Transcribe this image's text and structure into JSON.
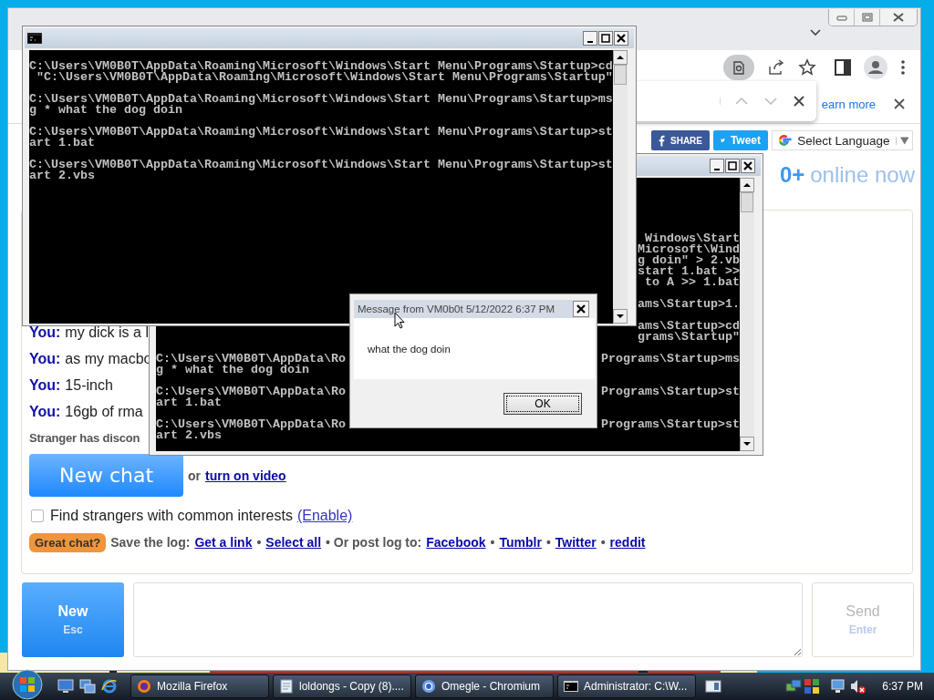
{
  "browser": {
    "infobar": {
      "link": "earn more"
    },
    "share": {
      "facebook": "SHARE",
      "twitter": "Tweet"
    },
    "language": {
      "label": "Select Language"
    },
    "online": {
      "count": "0+",
      "label": "online now"
    },
    "chat": {
      "messages": [
        {
          "who": "You:",
          "text": "my dick is a l"
        },
        {
          "who": "You:",
          "text": "as my macbo"
        },
        {
          "who": "You:",
          "text": "15-inch"
        },
        {
          "who": "You:",
          "text": "16gb of rma"
        }
      ],
      "status": "Stranger has discon",
      "new_chat": "New chat",
      "or": "or",
      "video_link": "turn on video",
      "interests": {
        "checked": false,
        "label": "Find strangers with common interests",
        "link": "(Enable)"
      },
      "great_chat": "Great chat?",
      "log": [
        {
          "kind": "label",
          "text": "Save the log:"
        },
        {
          "kind": "link",
          "text": "Get a link"
        },
        {
          "kind": "label",
          "text": "•"
        },
        {
          "kind": "link",
          "text": "Select all"
        },
        {
          "kind": "label",
          "text": "• Or post log to:"
        },
        {
          "kind": "link",
          "text": "Facebook"
        },
        {
          "kind": "label",
          "text": "•"
        },
        {
          "kind": "link",
          "text": "Tumblr"
        },
        {
          "kind": "label",
          "text": "•"
        },
        {
          "kind": "link",
          "text": "Twitter"
        },
        {
          "kind": "label",
          "text": "•"
        },
        {
          "kind": "link",
          "text": "reddit"
        }
      ]
    },
    "input": {
      "new": "New",
      "new_key": "Esc",
      "send": "Send",
      "send_key": "Enter",
      "send_disabled": true
    }
  },
  "consoles": [
    {
      "blocks": [
        {
          "rows": [
            {
              "left": "C:\\Users\\VM0B0T\\AppData\\Roaming\\Microsoft\\Windows\\Start Menu\\Programs\\Startup>cd"
            },
            {
              "left": " \"C:\\Users\\VM0B0T\\AppData\\Roaming\\Microsoft\\Windows\\Start Menu\\Programs\\Startup\""
            }
          ]
        },
        {
          "rows": [
            {
              "left": "C:\\Users\\VM0B0T\\AppData\\Roaming\\Microsoft\\Windows\\Start Menu\\Programs\\Startup>ms"
            },
            {
              "left": "g * what the dog doin"
            }
          ]
        },
        {
          "rows": [
            {
              "left": "C:\\Users\\VM0B0T\\AppData\\Roaming\\Microsoft\\Windows\\Start Menu\\Programs\\Startup>st"
            },
            {
              "left": "art 1.bat"
            }
          ]
        },
        {
          "rows": [
            {
              "left": "C:\\Users\\VM0B0T\\AppData\\Roaming\\Microsoft\\Windows\\Start Menu\\Programs\\Startup>st"
            },
            {
              "left": "art 2.vbs"
            }
          ]
        }
      ]
    },
    {
      "blocks": [
        {
          "rows": [
            {
              "right": "Windows\\Start"
            },
            {
              "right": "Microsoft\\Wind"
            },
            {
              "right": "g doin\" > 2.vb"
            },
            {
              "right": "start 1.bat >>"
            },
            {
              "right": "to A >> 1.bat"
            }
          ]
        },
        {
          "rows": [
            {
              "right": "ams\\Startup>1."
            }
          ]
        },
        {
          "rows": [
            {
              "right": "ams\\Startup>cd"
            },
            {
              "right": "grams\\Startup\""
            }
          ]
        },
        {
          "rows": [
            {
              "left": "C:\\Users\\VM0B0T\\AppData\\Ro",
              "right": "Programs\\Startup>ms"
            },
            {
              "left": "g * what the dog doin"
            }
          ]
        },
        {
          "rows": [
            {
              "left": "C:\\Users\\VM0B0T\\AppData\\Ro",
              "right": "Programs\\Startup>st"
            },
            {
              "left": "art 1.bat"
            }
          ]
        },
        {
          "rows": [
            {
              "left": "C:\\Users\\VM0B0T\\AppData\\Ro",
              "right": "Programs\\Startup>st"
            },
            {
              "left": "art 2.vbs"
            }
          ]
        }
      ]
    }
  ],
  "message_box": {
    "title": "Message from VM0b0t 5/12/2022 6:37 PM",
    "text": "what the dog doin",
    "button": "OK"
  },
  "taskbar": {
    "tasks": [
      {
        "kind": "firefox",
        "label": "Mozilla Firefox"
      },
      {
        "kind": "notepad",
        "label": "loldongs - Copy (8)...."
      },
      {
        "kind": "chromium",
        "label": "Omegle - Chromium"
      },
      {
        "kind": "console",
        "label": "Administrator: C:\\W..."
      }
    ],
    "clock": "6:37 PM"
  }
}
